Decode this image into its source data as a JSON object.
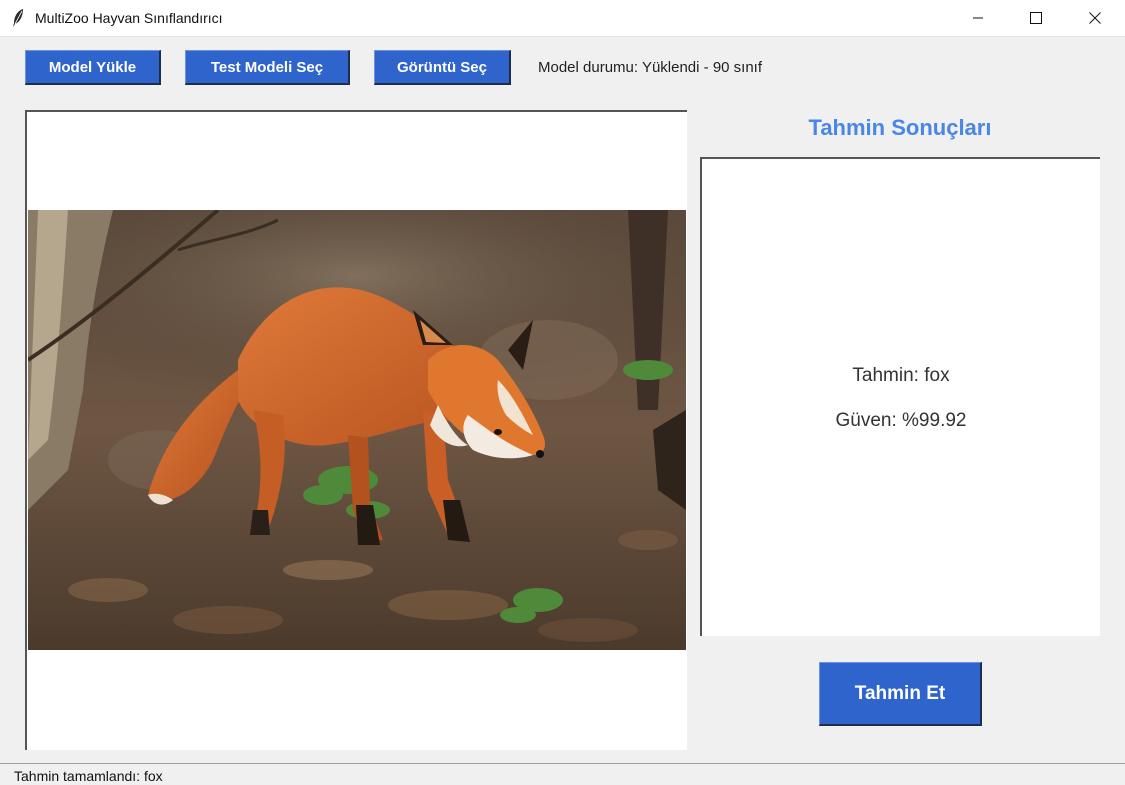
{
  "window": {
    "title": "MultiZoo Hayvan Sınıflandırıcı",
    "app_icon": "feather-icon",
    "controls": [
      "minimize-icon",
      "maximize-icon",
      "close-icon"
    ]
  },
  "toolbar": {
    "load_model_label": "Model Yükle",
    "select_test_model_label": "Test Modeli Seç",
    "select_image_label": "Görüntü Seç",
    "model_status": "Model durumu: Yüklendi - 90 sınıf"
  },
  "image_panel": {
    "photo_subject": "fox"
  },
  "results": {
    "title": "Tahmin Sonuçları",
    "prediction": "Tahmin: fox",
    "confidence": "Güven: %99.92",
    "predict_button_label": "Tahmin Et"
  },
  "statusbar": {
    "text": "Tahmin tamamlandı: fox"
  },
  "colors": {
    "button_bg": "#2f64cc",
    "title_accent": "#4a86e8",
    "window_bg": "#f0f0f0"
  }
}
